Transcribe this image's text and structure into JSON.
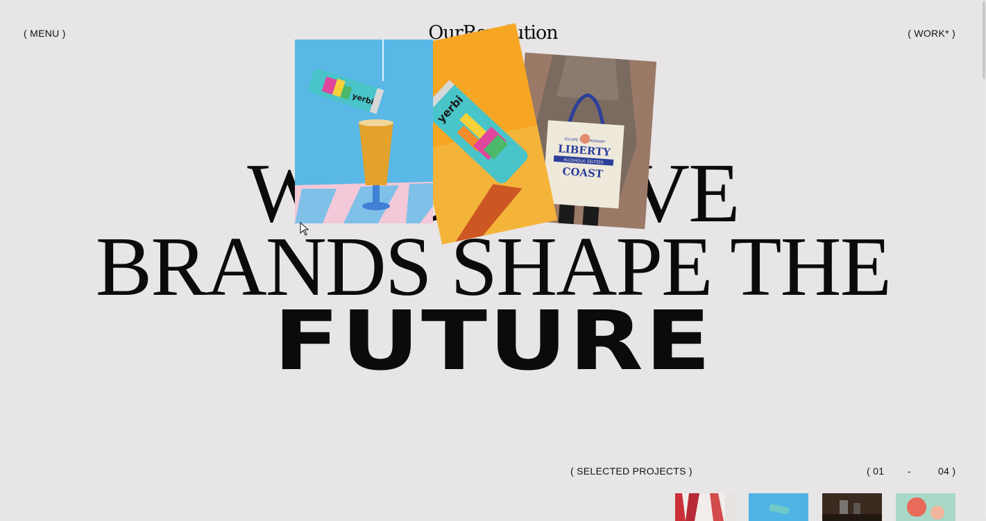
{
  "header": {
    "menu_label": "( MENU )",
    "logo_text": "OurRevolution",
    "work_label": "( WORK* )"
  },
  "hero": {
    "line1": "WE BELIEVE",
    "line2": "BRANDS SHAPE THE",
    "line3": "FUTURE"
  },
  "hero_images": [
    {
      "name": "drink-can-pour-photo",
      "can_text": "yerbi"
    },
    {
      "name": "drink-can-orange-photo",
      "can_text": "yerbi"
    },
    {
      "name": "liberty-coast-tote-photo",
      "tote_text": [
        "ESCAPE THE ORDINARY",
        "LIBERTY",
        "ALCOHOLIC SELTZER",
        "COAST"
      ]
    }
  ],
  "projects": {
    "section_label": "( SELECTED PROJECTS )",
    "counter_start": "( 01",
    "counter_sep": "-",
    "counter_end": "04 )",
    "thumbnails": [
      "project-thumb-1",
      "project-thumb-2",
      "project-thumb-3",
      "project-thumb-4"
    ]
  },
  "colors": {
    "background": "#e7e5e6",
    "text": "#0b0b0b",
    "accent_orange": "#f6a623",
    "accent_blue": "#5ab8e6"
  }
}
